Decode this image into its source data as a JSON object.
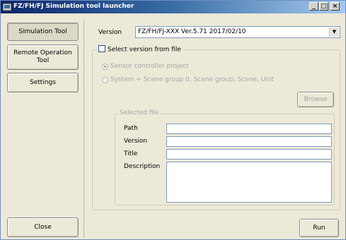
{
  "window": {
    "title": "FZ/FH/FJ Simulation tool launcher",
    "minimize_label": "_",
    "maximize_label": "□",
    "close_label": "×"
  },
  "sidebar": {
    "items": [
      {
        "label": "Simulation Tool",
        "active": true
      },
      {
        "label": "Remote Operation Tool",
        "active": false
      },
      {
        "label": "Settings",
        "active": false
      }
    ],
    "close_label": "Close"
  },
  "main": {
    "version_label": "Version",
    "version_value": "FZ/FH/FJ-XXX Ver.5.71 2017/02/10",
    "select_from_file_label": "Select version from file",
    "select_from_file_checked": false,
    "radio_options": [
      {
        "label": "Sensor controller project",
        "checked": true
      },
      {
        "label": "System + Scene group 0, Scene group, Scene, Unit",
        "checked": false
      }
    ],
    "browse_label": "Browse",
    "selected_file": {
      "group_label": "Selected file",
      "path_label": "Path",
      "path_value": "",
      "version_label": "Version",
      "version_value": "",
      "title_label": "Title",
      "title_value": "",
      "description_label": "Description",
      "description_value": ""
    },
    "run_label": "Run"
  }
}
